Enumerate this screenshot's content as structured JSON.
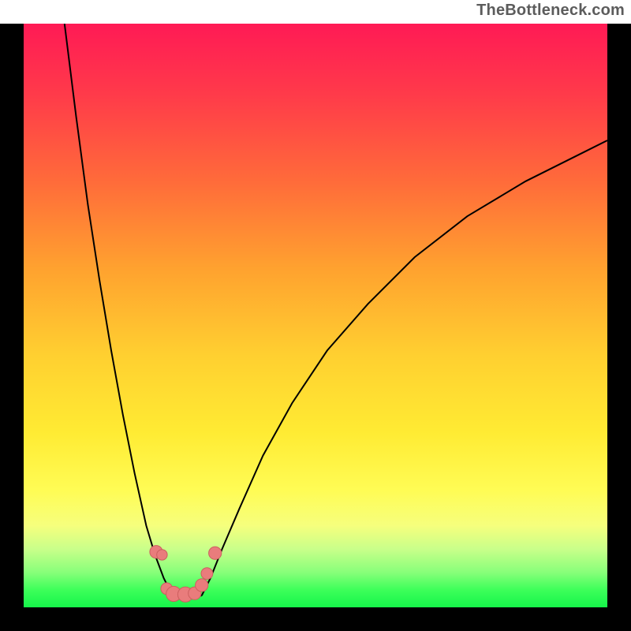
{
  "watermark": "TheBottleneck.com",
  "colors": {
    "curve": "#000000",
    "marker_fill": "#e97c7c",
    "marker_stroke": "#cc5f5f"
  },
  "chart_data": {
    "type": "line",
    "title": "",
    "xlabel": "",
    "ylabel": "",
    "xlim": [
      0,
      100
    ],
    "ylim": [
      0,
      100
    ],
    "series": [
      {
        "name": "left-branch",
        "x": [
          7,
          9,
          11,
          13,
          15,
          17,
          19,
          21,
          22.5,
          24,
          25.5
        ],
        "y": [
          100,
          84,
          69,
          56,
          44,
          33,
          23,
          14,
          9,
          5,
          2
        ]
      },
      {
        "name": "right-branch",
        "x": [
          30.5,
          32,
          34,
          37,
          41,
          46,
          52,
          59,
          67,
          76,
          86,
          96,
          100
        ],
        "y": [
          2,
          5,
          10,
          17,
          26,
          35,
          44,
          52,
          60,
          67,
          73,
          78,
          80
        ]
      },
      {
        "name": "flat-bottom",
        "x": [
          25.5,
          30.5
        ],
        "y": [
          2,
          2
        ]
      }
    ],
    "markers": [
      {
        "x": 22.7,
        "y": 9.5,
        "r": 1.1
      },
      {
        "x": 23.7,
        "y": 9.0,
        "r": 0.9
      },
      {
        "x": 24.5,
        "y": 3.2,
        "r": 1.0
      },
      {
        "x": 25.7,
        "y": 2.3,
        "r": 1.3
      },
      {
        "x": 27.7,
        "y": 2.2,
        "r": 1.3
      },
      {
        "x": 29.3,
        "y": 2.4,
        "r": 1.1
      },
      {
        "x": 30.5,
        "y": 3.8,
        "r": 1.1
      },
      {
        "x": 31.4,
        "y": 5.8,
        "r": 1.0
      },
      {
        "x": 32.8,
        "y": 9.3,
        "r": 1.1
      }
    ]
  }
}
